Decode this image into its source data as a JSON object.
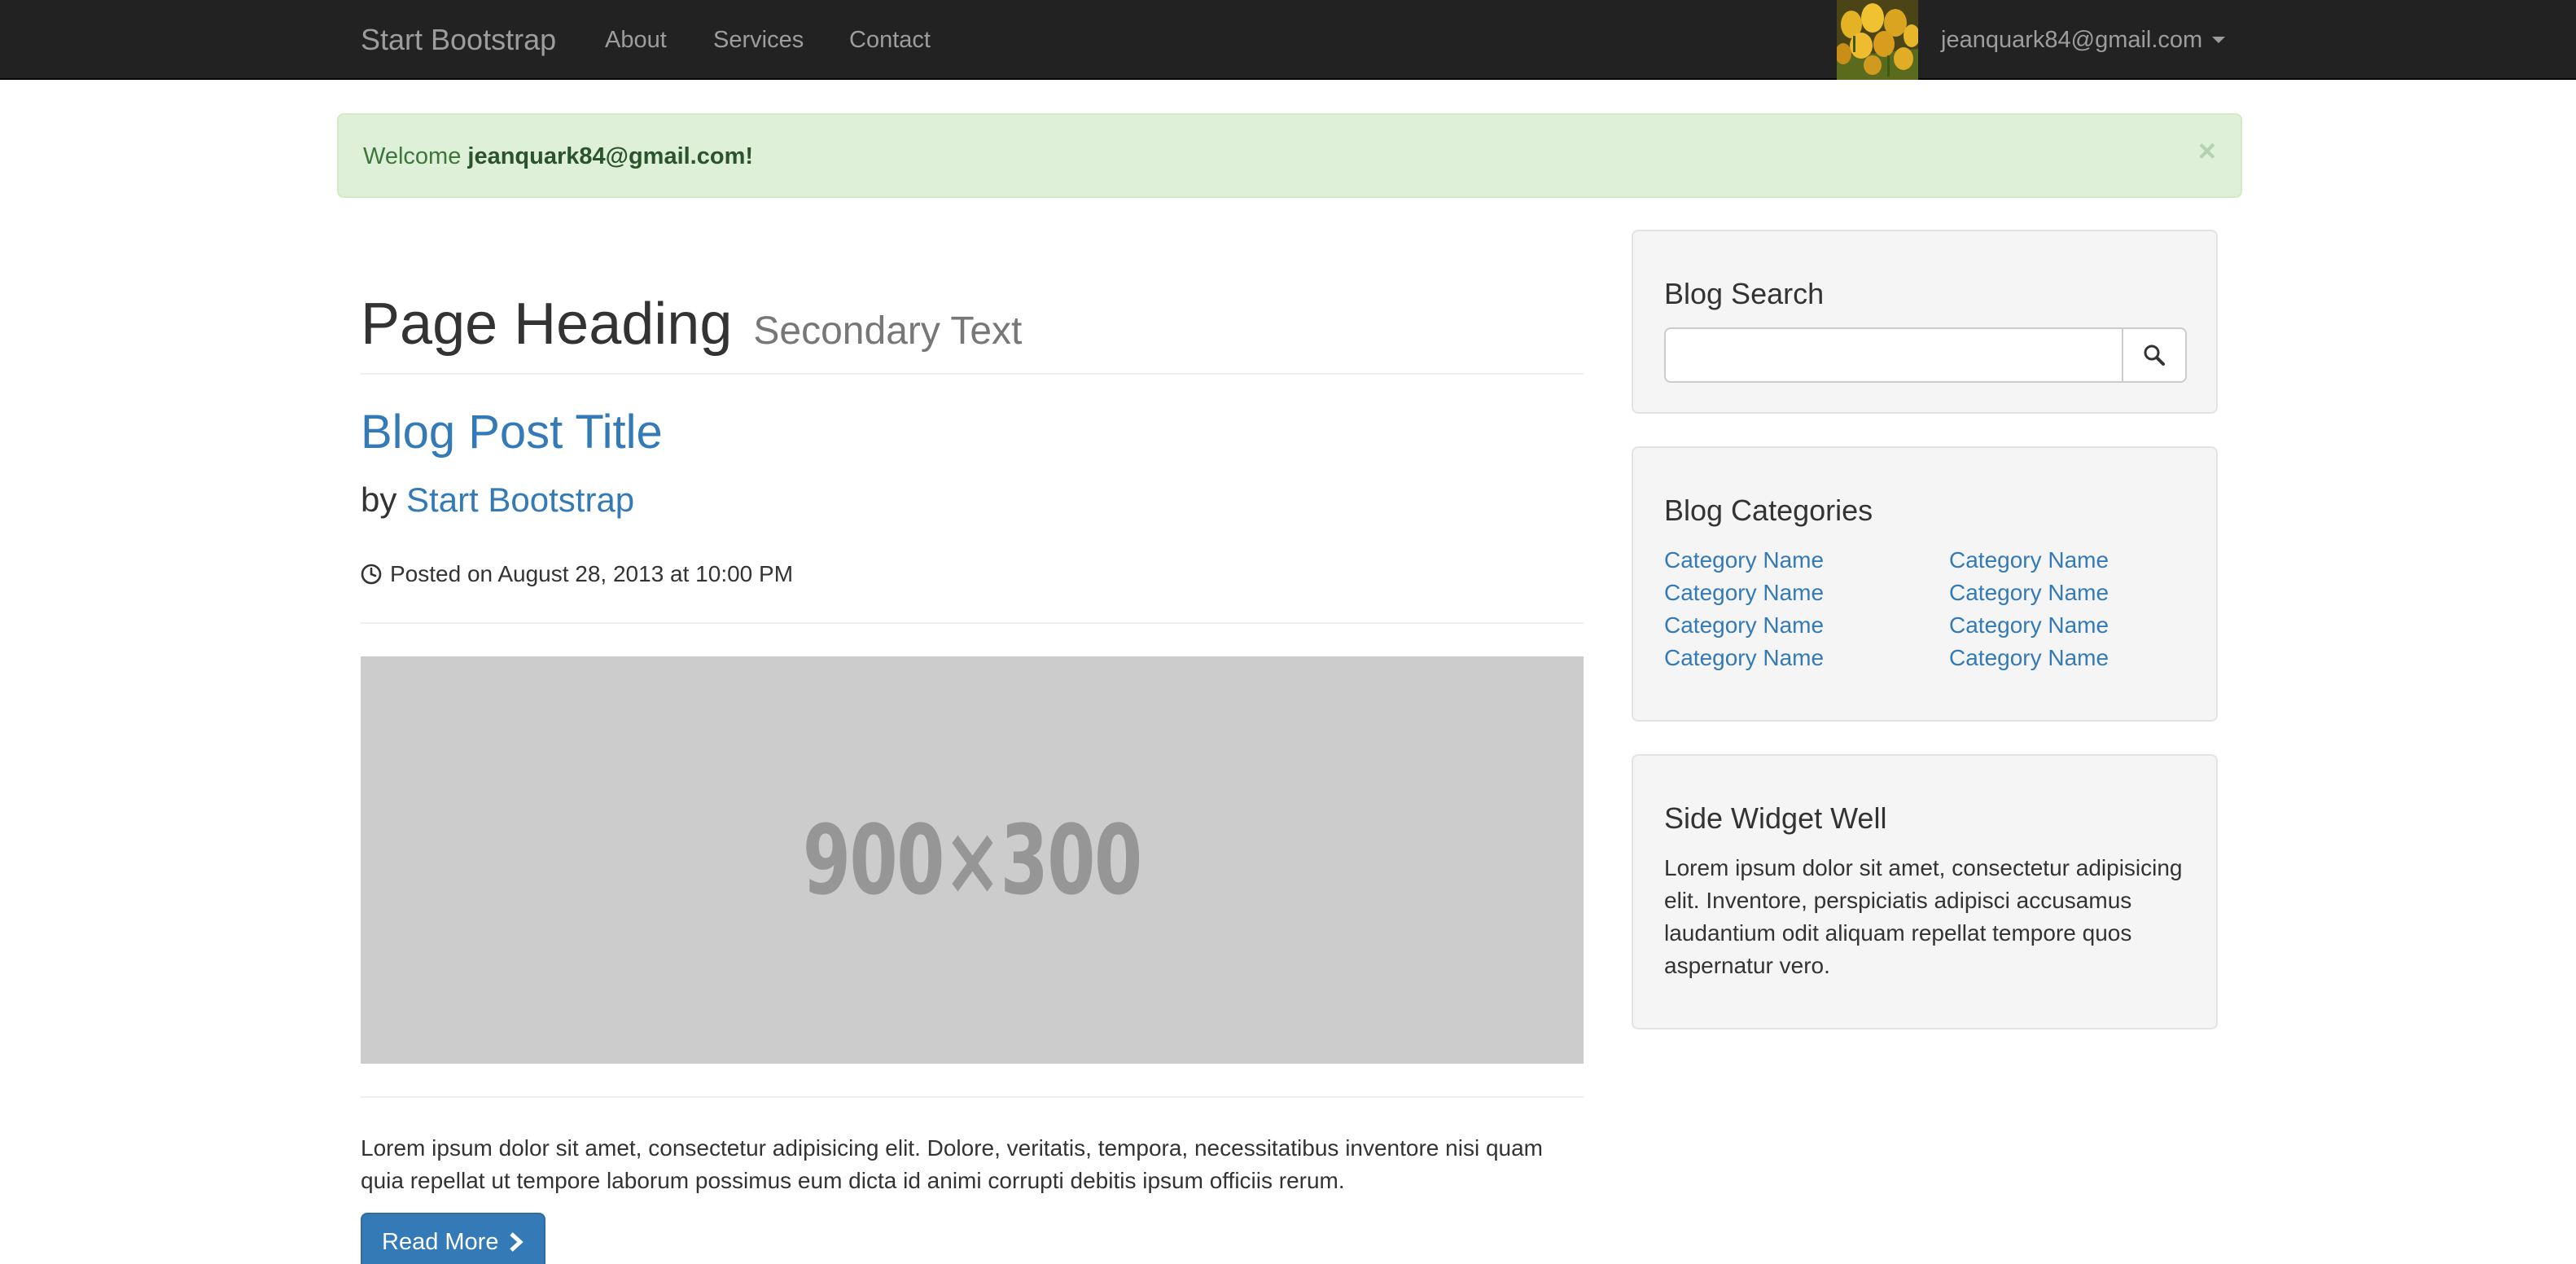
{
  "navbar": {
    "brand": "Start Bootstrap",
    "links": [
      "About",
      "Services",
      "Contact"
    ],
    "user_email": "jeanquark84@gmail.com"
  },
  "alert": {
    "prefix": "Welcome",
    "email": "jeanquark84@gmail.com!",
    "close_symbol": "×"
  },
  "main": {
    "page_heading": "Page Heading",
    "page_subheading": "Secondary Text",
    "post_title": "Blog Post Title",
    "by_prefix": "by",
    "author": "Start Bootstrap",
    "posted": "Posted on August 28, 2013 at 10:00 PM",
    "image_placeholder": "900×300",
    "body": "Lorem ipsum dolor sit amet, consectetur adipisicing elit. Dolore, veritatis, tempora, necessitatibus inventore nisi quam quia repellat ut tempore laborum possimus eum dicta id animi corrupti debitis ipsum officiis rerum.",
    "read_more": "Read More"
  },
  "sidebar": {
    "search": {
      "title": "Blog Search",
      "value": ""
    },
    "categories": {
      "title": "Blog Categories",
      "left": [
        "Category Name",
        "Category Name",
        "Category Name",
        "Category Name"
      ],
      "right": [
        "Category Name",
        "Category Name",
        "Category Name",
        "Category Name"
      ]
    },
    "widget": {
      "title": "Side Widget Well",
      "text": "Lorem ipsum dolor sit amet, consectetur adipisicing elit. Inventore, perspiciatis adipisci accusamus laudantium odit aliquam repellat tempore quos aspernatur vero."
    }
  },
  "colors": {
    "navbar_bg": "#222222",
    "link": "#337ab7",
    "alert_bg": "#dff0d8",
    "alert_text": "#3c763d",
    "well_bg": "#f5f5f5",
    "button_primary": "#337ab7"
  },
  "icons": {
    "clock": "clock-icon",
    "search": "search-icon",
    "chevron": "chevron-right-icon",
    "caret": "caret-down-icon"
  }
}
